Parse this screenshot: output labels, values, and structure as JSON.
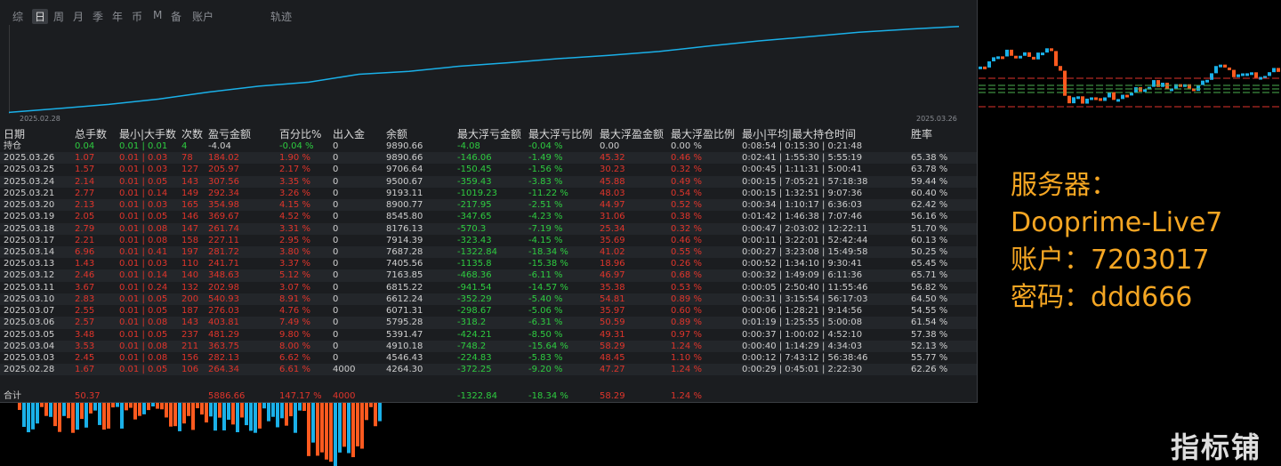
{
  "tabs": [
    {
      "label": "综",
      "active": false
    },
    {
      "label": "日",
      "active": true
    },
    {
      "label": "周",
      "active": false
    },
    {
      "label": "月",
      "active": false
    },
    {
      "label": "季",
      "active": false
    },
    {
      "label": "年",
      "active": false
    },
    {
      "label": "币",
      "active": false
    },
    {
      "label": "M",
      "active": false
    },
    {
      "label": "备",
      "active": false
    },
    {
      "label": "账户",
      "active": false
    },
    {
      "label": "轨迹",
      "active": false
    }
  ],
  "equity": {
    "start_date": "2025.02.28",
    "end_date": "2025.03.26",
    "line_color": "#1ab0e8"
  },
  "headers": [
    "日期",
    "总手数",
    "最小|大手数",
    "次数",
    "盈亏金额",
    "百分比%",
    "出入金",
    "余额",
    "最大浮亏金额",
    "最大浮亏比例",
    "最大浮盈金额",
    "最大浮盈比例",
    "最小|平均|最大持仓时间",
    "胜率"
  ],
  "holding": {
    "date": "持仓",
    "lots": "0.04",
    "minmax": "0.01 | 0.01",
    "count": "4",
    "pnl": "-4.04",
    "pct": "-0.04 %",
    "flow": "0",
    "balance": "9890.66",
    "maxdd": "-4.08",
    "maxdd_pct": "-0.04 %",
    "maxfp": "0.00",
    "maxfp_pct": "0.00 %",
    "hold": "0:08:54 | 0:15:30 | 0:21:48",
    "win": ""
  },
  "rows": [
    {
      "date": "2025.03.26",
      "lots": "1.07",
      "minmax": "0.01 | 0.03",
      "count": "78",
      "pnl": "184.02",
      "pct": "1.90 %",
      "flow": "0",
      "balance": "9890.66",
      "maxdd": "-146.06",
      "maxdd_pct": "-1.49 %",
      "maxfp": "45.32",
      "maxfp_pct": "0.46 %",
      "hold": "0:02:41 | 1:55:30 | 5:55:19",
      "win": "65.38 %"
    },
    {
      "date": "2025.03.25",
      "lots": "1.57",
      "minmax": "0.01 | 0.03",
      "count": "127",
      "pnl": "205.97",
      "pct": "2.17 %",
      "flow": "0",
      "balance": "9706.64",
      "maxdd": "-150.45",
      "maxdd_pct": "-1.56 %",
      "maxfp": "30.23",
      "maxfp_pct": "0.32 %",
      "hold": "0:00:45 | 1:11:31 | 5:00:41",
      "win": "63.78 %"
    },
    {
      "date": "2025.03.24",
      "lots": "2.14",
      "minmax": "0.01 | 0.05",
      "count": "143",
      "pnl": "307.56",
      "pct": "3.35 %",
      "flow": "0",
      "balance": "9500.67",
      "maxdd": "-359.43",
      "maxdd_pct": "-3.83 %",
      "maxfp": "45.88",
      "maxfp_pct": "0.49 %",
      "hold": "0:00:15 | 7:05:21 | 57:18:38",
      "win": "59.44 %"
    },
    {
      "date": "2025.03.21",
      "lots": "2.77",
      "minmax": "0.01 | 0.14",
      "count": "149",
      "pnl": "292.34",
      "pct": "3.26 %",
      "flow": "0",
      "balance": "9193.11",
      "maxdd": "-1019.23",
      "maxdd_pct": "-11.22 %",
      "maxfp": "48.03",
      "maxfp_pct": "0.54 %",
      "hold": "0:00:15 | 1:32:51 | 9:07:36",
      "win": "60.40 %"
    },
    {
      "date": "2025.03.20",
      "lots": "2.13",
      "minmax": "0.01 | 0.03",
      "count": "165",
      "pnl": "354.98",
      "pct": "4.15 %",
      "flow": "0",
      "balance": "8900.77",
      "maxdd": "-217.95",
      "maxdd_pct": "-2.51 %",
      "maxfp": "44.97",
      "maxfp_pct": "0.52 %",
      "hold": "0:00:34 | 1:10:17 | 6:36:03",
      "win": "62.42 %"
    },
    {
      "date": "2025.03.19",
      "lots": "2.05",
      "minmax": "0.01 | 0.05",
      "count": "146",
      "pnl": "369.67",
      "pct": "4.52 %",
      "flow": "0",
      "balance": "8545.80",
      "maxdd": "-347.65",
      "maxdd_pct": "-4.23 %",
      "maxfp": "31.06",
      "maxfp_pct": "0.38 %",
      "hold": "0:01:42 | 1:46:38 | 7:07:46",
      "win": "56.16 %"
    },
    {
      "date": "2025.03.18",
      "lots": "2.79",
      "minmax": "0.01 | 0.08",
      "count": "147",
      "pnl": "261.74",
      "pct": "3.31 %",
      "flow": "0",
      "balance": "8176.13",
      "maxdd": "-570.3",
      "maxdd_pct": "-7.19 %",
      "maxfp": "25.34",
      "maxfp_pct": "0.32 %",
      "hold": "0:00:47 | 2:03:02 | 12:22:11",
      "win": "51.70 %"
    },
    {
      "date": "2025.03.17",
      "lots": "2.21",
      "minmax": "0.01 | 0.08",
      "count": "158",
      "pnl": "227.11",
      "pct": "2.95 %",
      "flow": "0",
      "balance": "7914.39",
      "maxdd": "-323.43",
      "maxdd_pct": "-4.15 %",
      "maxfp": "35.69",
      "maxfp_pct": "0.46 %",
      "hold": "0:00:11 | 3:22:01 | 52:42:44",
      "win": "60.13 %"
    },
    {
      "date": "2025.03.14",
      "lots": "6.96",
      "minmax": "0.01 | 0.41",
      "count": "197",
      "pnl": "281.72",
      "pct": "3.80 %",
      "flow": "0",
      "balance": "7687.28",
      "maxdd": "-1322.84",
      "maxdd_pct": "-18.34 %",
      "maxfp": "41.02",
      "maxfp_pct": "0.55 %",
      "hold": "0:00:27 | 3:23:08 | 15:49:58",
      "win": "50.25 %"
    },
    {
      "date": "2025.03.13",
      "lots": "1.43",
      "minmax": "0.01 | 0.03",
      "count": "110",
      "pnl": "241.71",
      "pct": "3.37 %",
      "flow": "0",
      "balance": "7405.56",
      "maxdd": "-1135.8",
      "maxdd_pct": "-15.38 %",
      "maxfp": "18.96",
      "maxfp_pct": "0.26 %",
      "hold": "0:00:52 | 1:34:10 | 9:30:41",
      "win": "65.45 %"
    },
    {
      "date": "2025.03.12",
      "lots": "2.46",
      "minmax": "0.01 | 0.14",
      "count": "140",
      "pnl": "348.63",
      "pct": "5.12 %",
      "flow": "0",
      "balance": "7163.85",
      "maxdd": "-468.36",
      "maxdd_pct": "-6.11 %",
      "maxfp": "46.97",
      "maxfp_pct": "0.68 %",
      "hold": "0:00:32 | 1:49:09 | 6:11:36",
      "win": "65.71 %"
    },
    {
      "date": "2025.03.11",
      "lots": "3.67",
      "minmax": "0.01 | 0.24",
      "count": "132",
      "pnl": "202.98",
      "pct": "3.07 %",
      "flow": "0",
      "balance": "6815.22",
      "maxdd": "-941.54",
      "maxdd_pct": "-14.57 %",
      "maxfp": "35.38",
      "maxfp_pct": "0.53 %",
      "hold": "0:00:05 | 2:50:40 | 11:55:46",
      "win": "56.82 %"
    },
    {
      "date": "2025.03.10",
      "lots": "2.83",
      "minmax": "0.01 | 0.05",
      "count": "200",
      "pnl": "540.93",
      "pct": "8.91 %",
      "flow": "0",
      "balance": "6612.24",
      "maxdd": "-352.29",
      "maxdd_pct": "-5.40 %",
      "maxfp": "54.81",
      "maxfp_pct": "0.89 %",
      "hold": "0:00:31 | 3:15:54 | 56:17:03",
      "win": "64.50 %"
    },
    {
      "date": "2025.03.07",
      "lots": "2.55",
      "minmax": "0.01 | 0.05",
      "count": "187",
      "pnl": "276.03",
      "pct": "4.76 %",
      "flow": "0",
      "balance": "6071.31",
      "maxdd": "-298.67",
      "maxdd_pct": "-5.06 %",
      "maxfp": "35.97",
      "maxfp_pct": "0.60 %",
      "hold": "0:00:06 | 1:28:21 | 9:14:56",
      "win": "54.55 %"
    },
    {
      "date": "2025.03.06",
      "lots": "2.57",
      "minmax": "0.01 | 0.08",
      "count": "143",
      "pnl": "403.81",
      "pct": "7.49 %",
      "flow": "0",
      "balance": "5795.28",
      "maxdd": "-318.2",
      "maxdd_pct": "-6.31 %",
      "maxfp": "50.59",
      "maxfp_pct": "0.89 %",
      "hold": "0:01:19 | 1:25:55 | 5:00:08",
      "win": "61.54 %"
    },
    {
      "date": "2025.03.05",
      "lots": "3.48",
      "minmax": "0.01 | 0.05",
      "count": "237",
      "pnl": "481.29",
      "pct": "9.80 %",
      "flow": "0",
      "balance": "5391.47",
      "maxdd": "-424.21",
      "maxdd_pct": "-8.50 %",
      "maxfp": "49.31",
      "maxfp_pct": "0.97 %",
      "hold": "0:00:37 | 1:00:02 | 4:52:10",
      "win": "57.38 %"
    },
    {
      "date": "2025.03.04",
      "lots": "3.53",
      "minmax": "0.01 | 0.08",
      "count": "211",
      "pnl": "363.75",
      "pct": "8.00 %",
      "flow": "0",
      "balance": "4910.18",
      "maxdd": "-748.2",
      "maxdd_pct": "-15.64 %",
      "maxfp": "58.29",
      "maxfp_pct": "1.24 %",
      "hold": "0:00:40 | 1:14:29 | 4:34:03",
      "win": "52.13 %"
    },
    {
      "date": "2025.03.03",
      "lots": "2.45",
      "minmax": "0.01 | 0.08",
      "count": "156",
      "pnl": "282.13",
      "pct": "6.62 %",
      "flow": "0",
      "balance": "4546.43",
      "maxdd": "-224.83",
      "maxdd_pct": "-5.83 %",
      "maxfp": "48.45",
      "maxfp_pct": "1.10 %",
      "hold": "0:00:12 | 7:43:12 | 56:38:46",
      "win": "55.77 %"
    },
    {
      "date": "2025.02.28",
      "lots": "1.67",
      "minmax": "0.01 | 0.05",
      "count": "106",
      "pnl": "264.34",
      "pct": "6.61 %",
      "flow": "4000",
      "balance": "4264.30",
      "maxdd": "-372.25",
      "maxdd_pct": "-9.20 %",
      "maxfp": "47.27",
      "maxfp_pct": "1.24 %",
      "hold": "0:00:29 | 0:45:01 | 2:22:30",
      "win": "62.26 %"
    }
  ],
  "total": {
    "label": "合计",
    "lots": "50.37",
    "pnl": "5886.66",
    "pct": "147.17 %",
    "flow": "4000",
    "maxdd": "-1322.84",
    "maxdd_pct": "-18.34 %",
    "maxfp": "58.29",
    "maxfp_pct": "1.24 %"
  },
  "info": {
    "line1": "服务器：",
    "line2": "Dooprime-Live7",
    "line3": "账户：7203017",
    "line4": "密码：ddd666"
  },
  "watermark": "指标铺",
  "colors": {
    "up": "#1ab0e8",
    "down": "#ff5a1f",
    "red": "#e0352b",
    "green": "#2ecc40",
    "orange": "#f5a623"
  }
}
